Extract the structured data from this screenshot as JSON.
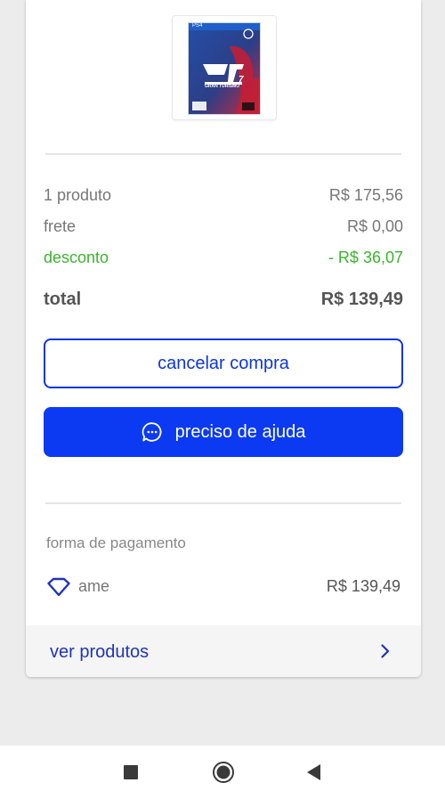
{
  "product": {
    "platform_badge": "PS4",
    "cover_title": "GRAN TURISMO",
    "cover_number": "7"
  },
  "summary": {
    "products_label": "1 produto",
    "products_value": "R$ 175,56",
    "shipping_label": "frete",
    "shipping_value": "R$ 0,00",
    "discount_label": "desconto",
    "discount_value": "- R$ 36,07",
    "total_label": "total",
    "total_value": "R$ 139,49"
  },
  "actions": {
    "cancel_label": "cancelar compra",
    "help_label": "preciso de ajuda"
  },
  "payment": {
    "title": "forma de pagamento",
    "method": "ame",
    "amount": "R$ 139,49"
  },
  "footer": {
    "view_products_label": "ver produtos"
  },
  "colors": {
    "accent": "#0b3af2",
    "link": "#1f34bd",
    "discount": "#39b52c"
  },
  "icons": {
    "help": "chat-bubble-icon",
    "payment": "diamond-icon",
    "footer": "chevron-right-icon",
    "nav": [
      "recents-square-icon",
      "home-circle-icon",
      "back-triangle-icon"
    ]
  }
}
